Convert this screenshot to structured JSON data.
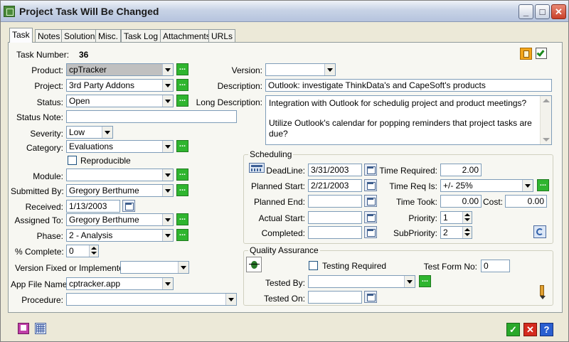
{
  "window": {
    "title": "Project Task Will Be Changed"
  },
  "tabs": [
    {
      "label": "Task"
    },
    {
      "label": "Notes"
    },
    {
      "label": "Solution"
    },
    {
      "label": "Misc."
    },
    {
      "label": "Task Log"
    },
    {
      "label": "Attachments"
    },
    {
      "label": "URLs"
    }
  ],
  "task": {
    "number_label": "Task Number:",
    "number_value": "36",
    "product_label": "Product:",
    "product_value": "cpTracker",
    "project_label": "Project:",
    "project_value": "3rd Party Addons",
    "status_label": "Status:",
    "status_value": "Open",
    "status_note_label": "Status Note:",
    "status_note_value": "",
    "severity_label": "Severity:",
    "severity_value": "Low",
    "category_label": "Category:",
    "category_value": "Evaluations",
    "reproducible_label": "Reproducible",
    "module_label": "Module:",
    "module_value": "",
    "submitted_by_label": "Submitted By:",
    "submitted_by_value": "Gregory Berthume",
    "received_label": "Received:",
    "received_value": "1/13/2003",
    "assigned_to_label": "Assigned To:",
    "assigned_to_value": "Gregory Berthume",
    "phase_label": "Phase:",
    "phase_value": "2 - Analysis",
    "complete_label": "% Complete:",
    "complete_value": "0",
    "version_fixed_label": "Version Fixed or Implemented:",
    "version_fixed_value": "",
    "app_file_label": "App File Name:",
    "app_file_value": "cptracker.app",
    "procedure_label": "Procedure:",
    "procedure_value": "",
    "version_label": "Version:",
    "version_value": "",
    "description_label": "Description:",
    "description_value": "Outlook: investigate ThinkData's and CapeSoft's products",
    "long_description_label": "Long Description:",
    "long_description_line1": "Integration with Outlook for schedulig project and product meetings?",
    "long_description_line2": "Utilize Outlook's calendar for popping reminders that project tasks are due?"
  },
  "scheduling": {
    "title": "Scheduling",
    "deadline_label": "DeadLine:",
    "deadline_value": "3/31/2003",
    "planned_start_label": "Planned Start:",
    "planned_start_value": "2/21/2003",
    "planned_end_label": "Planned End:",
    "planned_end_value": "",
    "actual_start_label": "Actual Start:",
    "actual_start_value": "",
    "completed_label": "Completed:",
    "completed_value": "",
    "time_required_label": "Time Required:",
    "time_required_value": "2.00",
    "time_req_is_label": "Time Req Is:",
    "time_req_is_value": "+/- 25%",
    "time_took_label": "Time Took:",
    "time_took_value": "0.00",
    "cost_label": "Cost:",
    "cost_value": "0.00",
    "priority_label": "Priority:",
    "priority_value": "1",
    "subpriority_label": "SubPriority:",
    "subpriority_value": "2"
  },
  "qa": {
    "title": "Quality Assurance",
    "testing_required_label": "Testing Required",
    "test_form_label": "Test Form No:",
    "test_form_value": "0",
    "tested_by_label": "Tested By:",
    "tested_by_value": "",
    "tested_on_label": "Tested On:",
    "tested_on_value": ""
  },
  "buttons": {
    "dots": "...",
    "ok": "✓",
    "cancel": "✕",
    "help": "?"
  }
}
